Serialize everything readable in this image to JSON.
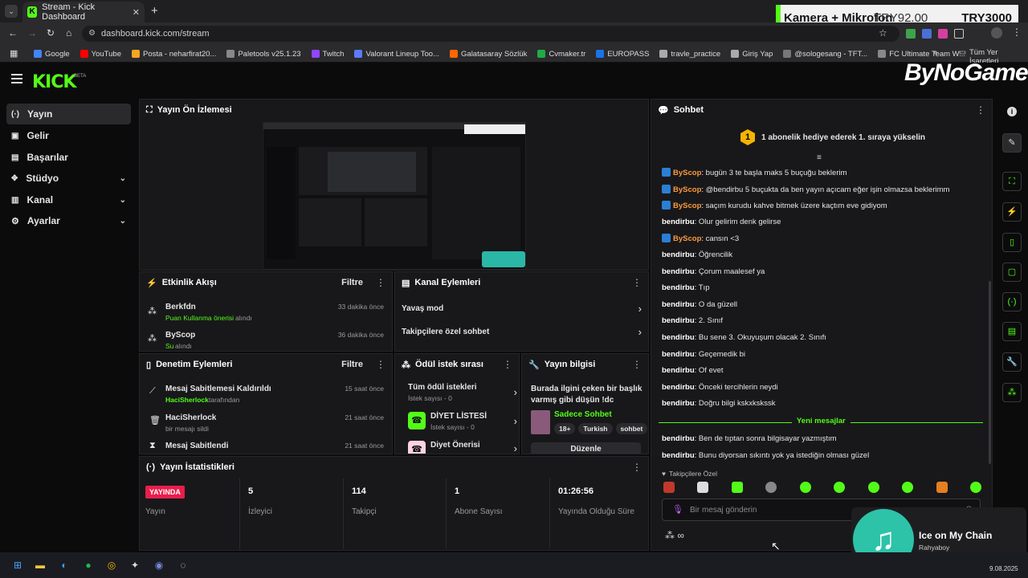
{
  "browser": {
    "tab_title": "Stream - Kick Dashboard",
    "url": "dashboard.kick.com/stream",
    "bookmarks": [
      "Google",
      "YouTube",
      "Posta - neharfirat20...",
      "Paletools v25.1.23",
      "Twitch",
      "Valorant Lineup Too...",
      "Galatasaray Sözlük",
      "Cvmaker.tr",
      "EUROPASS",
      "travle_practice",
      "Giriş Yap",
      "@sologesang - TFT...",
      "FC Ultimate Team W..."
    ],
    "all_bookmarks": "Tüm Yer İşaretleri"
  },
  "overlay": {
    "product": "Kamera + Mikrofon",
    "price": "TRY92.00",
    "total": "TRY3000",
    "brand": "ByNoGame"
  },
  "kick": {
    "logo": "KICK",
    "beta": "BETA"
  },
  "sidebar": {
    "items": [
      {
        "label": "Yayın"
      },
      {
        "label": "Gelir"
      },
      {
        "label": "Başarılar"
      },
      {
        "label": "Stüdyo"
      },
      {
        "label": "Kanal"
      },
      {
        "label": "Ayarlar"
      }
    ]
  },
  "preview": {
    "title": "Yayın Ön İzlemesi"
  },
  "activity": {
    "title": "Etkinlik Akışı",
    "filter": "Filtre",
    "items": [
      {
        "user": "Berkfdn",
        "action_hl": "Puan Kullanma önerisi",
        "action": "alındı",
        "time": "33 dakika önce"
      },
      {
        "user": "ByScop",
        "action_hl": "Su",
        "action": "alındı",
        "time": "36 dakika önce"
      }
    ]
  },
  "channel_actions": {
    "title": "Kanal Eylemleri",
    "items": [
      "Yavaş mod",
      "Takipçilere özel sohbet"
    ]
  },
  "moderation": {
    "title": "Denetim Eylemleri",
    "filter": "Filtre",
    "items": [
      {
        "title": "Mesaj Sabitlemesi Kaldırıldı",
        "by_hl": "HaciSherlock",
        "by": "tarafından",
        "time": "15 saat önce"
      },
      {
        "title": "HaciSherlock",
        "by_hl": "",
        "by": "bir mesajı sildi",
        "time": "21 saat önce"
      },
      {
        "title": "Mesaj Sabitlendi",
        "by_hl": "",
        "by": "",
        "time": "21 saat önce"
      }
    ]
  },
  "rewards": {
    "title": "Ödül istek sırası",
    "items": [
      {
        "title": "Tüm ödül istekleri",
        "sub": "İstek sayısı - 0"
      },
      {
        "title": "DİYET LİSTESİ",
        "sub": "İstek sayısı - 0"
      },
      {
        "title": "Diyet Önerisi",
        "sub": ""
      }
    ]
  },
  "stream_info": {
    "title": "Yayın bilgisi",
    "stream_title": "Burada ilgini çeken bir başlık varmış gibi düşün !dc",
    "category": "Sadece Sohbet",
    "tags": [
      "18+",
      "Turkish",
      "sohbet"
    ],
    "edit": "Düzenle"
  },
  "stats": {
    "title": "Yayın İstatistikleri",
    "live_badge": "YAYINDA",
    "live_label": "Yayın",
    "items": [
      {
        "value": "5",
        "label": "İzleyici"
      },
      {
        "value": "114",
        "label": "Takipçi"
      },
      {
        "value": "1",
        "label": "Abone Sayısı"
      },
      {
        "value": "01:26:56",
        "label": "Yayında Olduğu Süre"
      }
    ]
  },
  "chat": {
    "title": "Sohbet",
    "gift_banner": "1 abonelik hediye ederek 1. sıraya yükselin",
    "gift_rank": "1",
    "messages": [
      {
        "user": "ByScop",
        "text": "bugün 3 te başla maks 5 buçuğu beklerim",
        "badge": true
      },
      {
        "user": "ByScop",
        "text": "@bendirbu 5 buçukta da ben yayın açıcam eğer işin olmazsa beklerimm",
        "badge": true
      },
      {
        "user": "ByScop",
        "text": "saçım kurudu kahve bitmek üzere kaçtım eve gidiyom",
        "badge": true
      },
      {
        "user": "bendirbu",
        "text": "Olur gelirim denk gelirse",
        "badge": false
      },
      {
        "user": "ByScop",
        "text": "cansın <3",
        "badge": true
      },
      {
        "user": "bendirbu",
        "text": "Öğrencilik",
        "badge": false
      },
      {
        "user": "bendirbu",
        "text": "Çorum maalesef ya",
        "badge": false
      },
      {
        "user": "bendirbu",
        "text": "Tıp",
        "badge": false
      },
      {
        "user": "bendirbu",
        "text": "O da güzell",
        "badge": false
      },
      {
        "user": "bendirbu",
        "text": "2. Sınıf",
        "badge": false
      },
      {
        "user": "bendirbu",
        "text": "Bu sene 3. Okuyuşum olacak 2. Sınıfı",
        "badge": false
      },
      {
        "user": "bendirbu",
        "text": "Geçemedik bi",
        "badge": false
      },
      {
        "user": "bendirbu",
        "text": "Of evet",
        "badge": false
      },
      {
        "user": "bendirbu",
        "text": "Önceki tercihlerin neydi",
        "badge": false
      },
      {
        "user": "bendirbu",
        "text": "Doğru bilgi kskxkskssk",
        "badge": false
      }
    ],
    "new_messages": "Yeni mesajlar",
    "new": [
      {
        "user": "bendirbu",
        "text": "Ben de tıptan sonra bilgisayar yazmıştım"
      },
      {
        "user": "bendirbu",
        "text": "Bunu diyorsan sıkıntı yok ya istediğin olması güzel"
      }
    ],
    "followers_only": "Takipçilere Özel",
    "input_placeholder": "Bir mesaj gönderin"
  },
  "music": {
    "song": "Ice on My Chain",
    "artist": "Rahyaboy"
  },
  "taskbar": {
    "date": "9.08.2025"
  },
  "colors": {
    "accent": "#53fc18",
    "live": "#e91e4d",
    "chat_orange": "#ff9a3d"
  }
}
